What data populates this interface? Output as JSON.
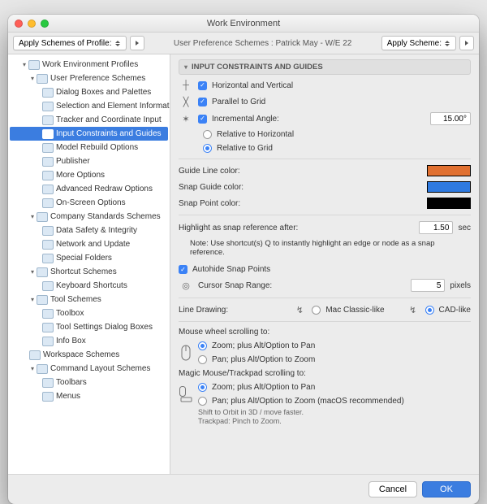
{
  "window": {
    "title": "Work Environment"
  },
  "toolbar": {
    "applySchemesLabel": "Apply Schemes of Profile:",
    "centerText": "User Preference Schemes : Patrick May - W/E 22",
    "applySchemeLabel": "Apply Scheme:"
  },
  "tree": [
    {
      "lvl": 1,
      "disc": true,
      "label": "Work Environment Profiles"
    },
    {
      "lvl": 2,
      "disc": true,
      "label": "User Preference Schemes"
    },
    {
      "lvl": 3,
      "label": "Dialog Boxes and Palettes"
    },
    {
      "lvl": 3,
      "label": "Selection and Element Information"
    },
    {
      "lvl": 3,
      "label": "Tracker and Coordinate Input"
    },
    {
      "lvl": 3,
      "label": "Input Constraints and Guides",
      "sel": true
    },
    {
      "lvl": 3,
      "label": "Model Rebuild Options"
    },
    {
      "lvl": 3,
      "label": "Publisher"
    },
    {
      "lvl": 3,
      "label": "More Options"
    },
    {
      "lvl": 3,
      "label": "Advanced Redraw Options"
    },
    {
      "lvl": 3,
      "label": "On-Screen Options"
    },
    {
      "lvl": 2,
      "disc": true,
      "label": "Company Standards Schemes"
    },
    {
      "lvl": 3,
      "label": "Data Safety & Integrity"
    },
    {
      "lvl": 3,
      "label": "Network and Update"
    },
    {
      "lvl": 3,
      "label": "Special Folders"
    },
    {
      "lvl": 2,
      "disc": true,
      "label": "Shortcut Schemes"
    },
    {
      "lvl": 3,
      "label": "Keyboard Shortcuts"
    },
    {
      "lvl": 2,
      "disc": true,
      "label": "Tool Schemes"
    },
    {
      "lvl": 3,
      "label": "Toolbox"
    },
    {
      "lvl": 3,
      "label": "Tool Settings Dialog Boxes"
    },
    {
      "lvl": 3,
      "label": "Info Box"
    },
    {
      "lvl": 2,
      "label": "Workspace Schemes"
    },
    {
      "lvl": 2,
      "disc": true,
      "label": "Command Layout Schemes"
    },
    {
      "lvl": 3,
      "label": "Toolbars"
    },
    {
      "lvl": 3,
      "label": "Menus"
    }
  ],
  "section": {
    "title": "INPUT CONSTRAINTS AND GUIDES"
  },
  "hv": {
    "label": "Horizontal and Vertical"
  },
  "parallel": {
    "label": "Parallel to Grid"
  },
  "incAngle": {
    "label": "Incremental Angle:",
    "value": "15.00°",
    "relH": "Relative to Horizontal",
    "relG": "Relative to Grid"
  },
  "colors": {
    "guideLabel": "Guide Line color:",
    "guide": "#e07030",
    "snapGuideLabel": "Snap Guide color:",
    "snapGuide": "#2f7ae0",
    "snapPointLabel": "Snap Point color:",
    "snapPoint": "#000000"
  },
  "highlight": {
    "label": "Highlight as snap reference after:",
    "value": "1.50",
    "unit": "sec"
  },
  "note": "Note: Use shortcut(s) Q to instantly highlight an edge or node as a snap reference.",
  "autohide": {
    "label": "Autohide Snap Points"
  },
  "snapRange": {
    "label": "Cursor Snap Range:",
    "value": "5",
    "unit": "pixels"
  },
  "lineDrawing": {
    "label": "Line Drawing:",
    "mac": "Mac Classic-like",
    "cad": "CAD-like"
  },
  "mouseWheel": {
    "label": "Mouse wheel scrolling to:",
    "opt1": "Zoom; plus Alt/Option to Pan",
    "opt2": "Pan; plus Alt/Option to Zoom"
  },
  "magic": {
    "label": "Magic Mouse/Trackpad scrolling to:",
    "opt1": "Zoom; plus Alt/Option to Pan",
    "opt2": "Pan; plus Alt/Option to Zoom (macOS recommended)",
    "hint1": "Shift to Orbit in 3D / move faster.",
    "hint2": "Trackpad: Pinch to Zoom."
  },
  "footer": {
    "cancel": "Cancel",
    "ok": "OK"
  }
}
